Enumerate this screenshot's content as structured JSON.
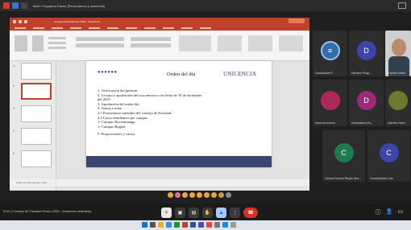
{
  "app": {
    "window_title": "Meet: Programa Pastor (Recordamos y comercial)"
  },
  "ppt": {
    "document_title": "consejo de facultad ene 2026 - PowerPoint",
    "status_text": "Haga clic para agregar notas"
  },
  "slide": {
    "heading": "Orden del día",
    "logo": "UNICENCIA",
    "items": [
      "1.  Verificación del quórum.",
      "2.  Lectura y aprobación del acta anterior con fecha de 10 de diciembre",
      "     del 2025",
      "3.  Aprobación del orden día.",
      "4.  Temas a tratar",
      "4.1  Posesiónese miembro del consejo de Facultad.",
      "4.2 Casos estudiantes por campus",
      "➢ Campus Bucaramanga",
      "➢ Campus Bogotá"
    ],
    "last_item": "5.       Proposiciones y varios."
  },
  "participants": [
    {
      "name": "Guardidosé F...",
      "initial": "",
      "color": "#2f6fb0",
      "icon": "circle-list-icon"
    },
    {
      "name": "Director Progr...",
      "initial": "D",
      "color": "#3b46a8"
    },
    {
      "name": "Carlos Forero",
      "initial": "",
      "color": "#555",
      "video": true
    },
    {
      "name": "cand.al.moreno",
      "initial": "",
      "color": "#b0285a",
      "icon": "pink-circle-icon"
    },
    {
      "name": "Decanatura Fa...",
      "initial": "D",
      "color": "#9c2a7a"
    },
    {
      "name": "Liberdo Hoch...",
      "initial": "",
      "color": "#6d7a2e",
      "icon": "green-circle-icon"
    },
    {
      "name": "Carlos Ernesto Reyes Mor...",
      "initial": "C",
      "color": "#1f7a4d"
    },
    {
      "name": "Coordinación Lalo",
      "initial": "C",
      "color": "#3b46a8"
    }
  ],
  "meeting": {
    "name": "9:54  |  Consejo de Facultad Enero 2026 - reuniones ordinarias"
  },
  "colors": {
    "accent": "#c0412a",
    "end_call": "#d93025"
  }
}
